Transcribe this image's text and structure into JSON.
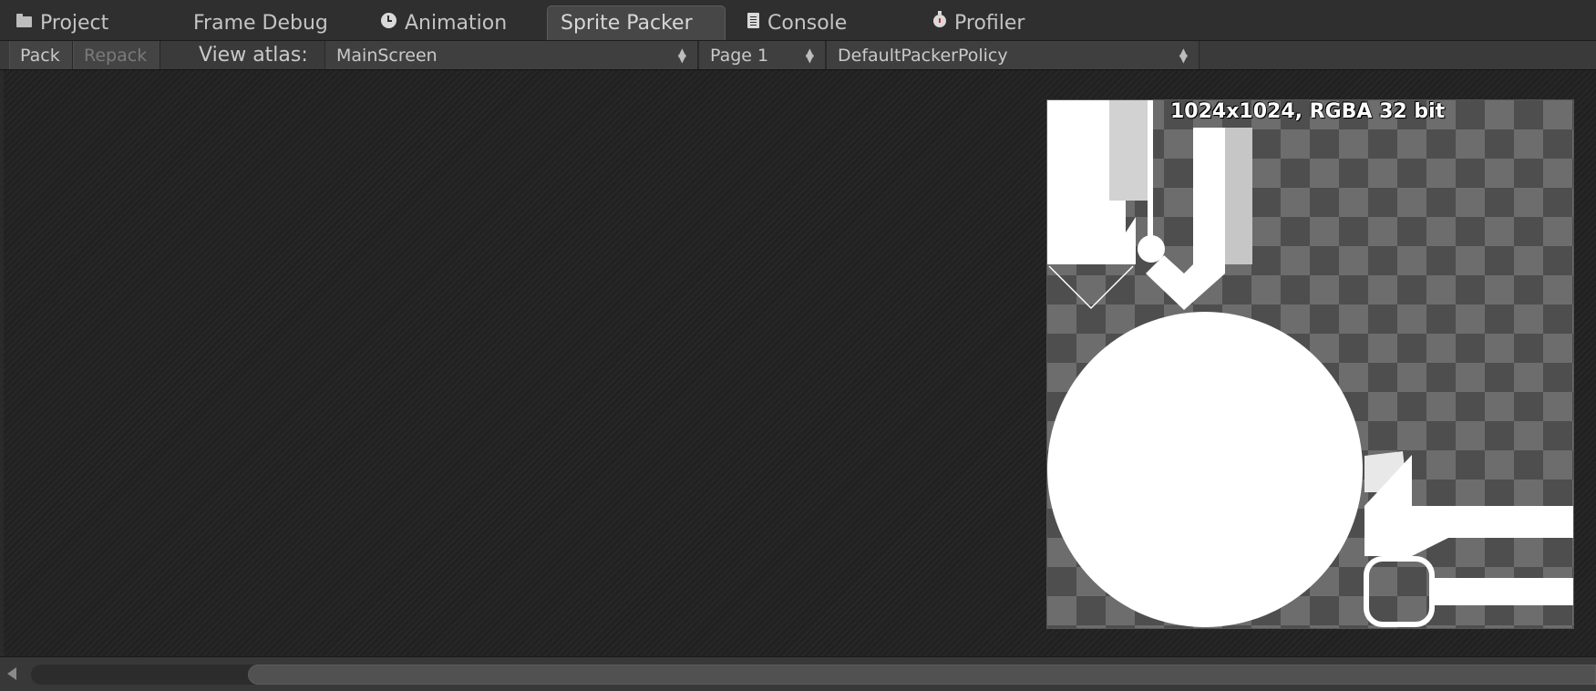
{
  "tabs": [
    {
      "label": "Project",
      "icon": "folder-icon"
    },
    {
      "label": "Frame Debug",
      "icon": ""
    },
    {
      "label": "Animation",
      "icon": "clock-icon"
    },
    {
      "label": "Sprite Packer",
      "icon": "",
      "active": true
    },
    {
      "label": "Console",
      "icon": "console-icon"
    },
    {
      "label": "Profiler",
      "icon": "profiler-icon"
    }
  ],
  "toolbar": {
    "pack_label": "Pack",
    "repack_label": "Repack",
    "view_atlas_label": "View atlas:",
    "atlas_value": "MainScreen",
    "page_value": "Page 1",
    "policy_value": "DefaultPackerPolicy"
  },
  "atlas": {
    "info": "1024x1024, RGBA 32 bit"
  },
  "colors": {
    "background": "#232323",
    "panel": "#2f2f2f",
    "active_tab": "#474747",
    "sprite": "#ffffff"
  }
}
